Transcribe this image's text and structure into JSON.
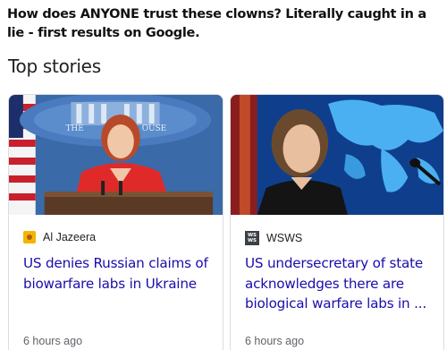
{
  "post": {
    "caption": "How does ANYONE trust these clowns? Literally caught in a lie - first results on Google."
  },
  "section": {
    "title": "Top stories"
  },
  "stories": [
    {
      "source": "Al Jazeera",
      "favicon": "al-jazeera-logo-icon",
      "headline": "US denies Russian claims of biowarfare labs in Ukraine",
      "time": "6 hours ago",
      "image_seal_text": "THE WHITE HOUSE"
    },
    {
      "source": "WSWS",
      "favicon": "wsws-logo-icon",
      "favicon_text": "WS WS",
      "headline": "US undersecretary of state acknowledges there are biological warfare labs in ...",
      "time": "6 hours ago"
    }
  ],
  "colors": {
    "headline_link": "#1a0dab",
    "meta_text": "#5f6368",
    "card_border": "#dadce0"
  }
}
